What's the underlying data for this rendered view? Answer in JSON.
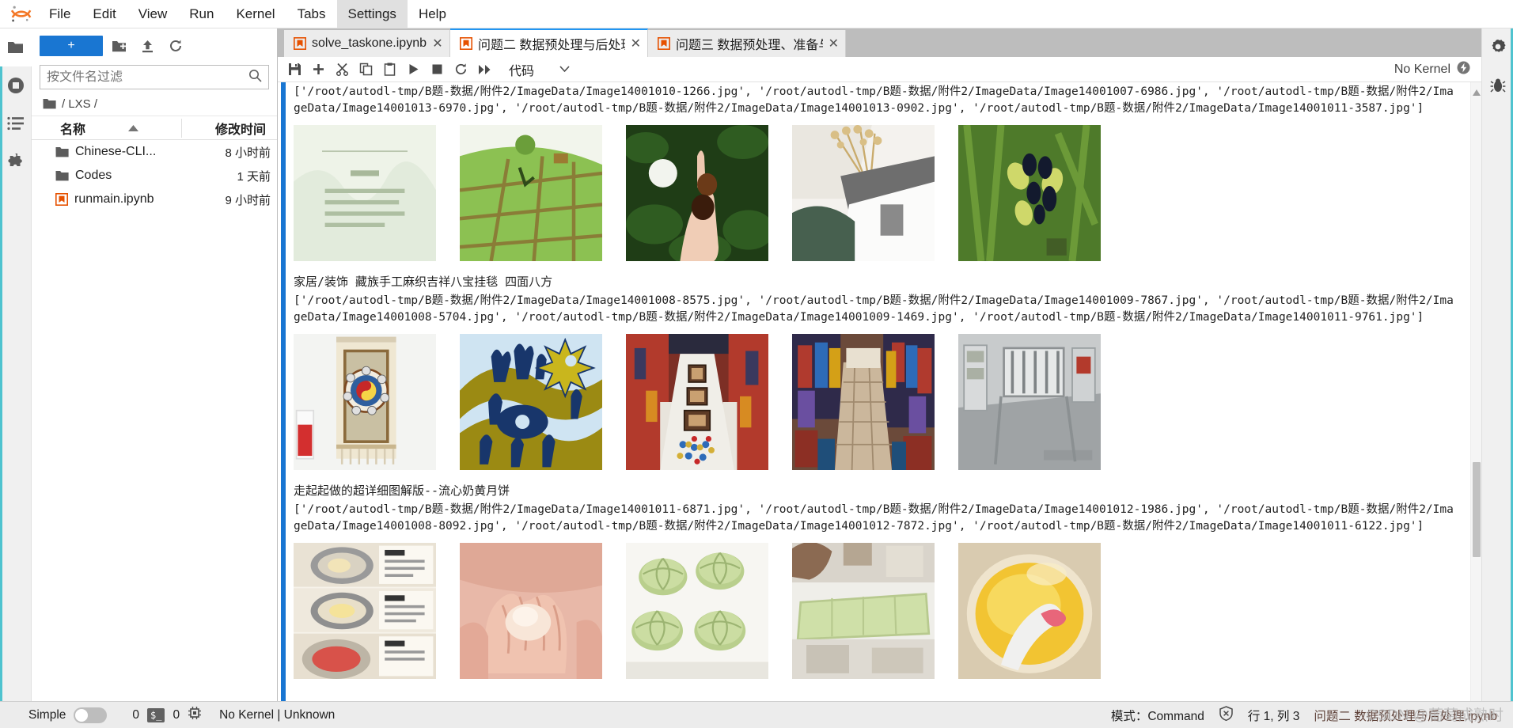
{
  "app": {
    "logo_icon": "jupyter-logo",
    "menus": [
      {
        "label": "File"
      },
      {
        "label": "Edit"
      },
      {
        "label": "View"
      },
      {
        "label": "Run"
      },
      {
        "label": "Kernel"
      },
      {
        "label": "Tabs"
      },
      {
        "label": "Settings",
        "active": true
      },
      {
        "label": "Help"
      }
    ]
  },
  "activity_bar": {
    "items": [
      {
        "name": "file-browser-icon",
        "icon": "folder-icon",
        "selected": true
      },
      {
        "name": "running-terminals-icon",
        "icon": "stop-circle-icon",
        "selected": false
      },
      {
        "name": "table-of-contents-icon",
        "icon": "list-icon",
        "selected": false
      },
      {
        "name": "extension-manager-icon",
        "icon": "puzzle-icon",
        "selected": false
      }
    ]
  },
  "right_bar": {
    "items": [
      {
        "name": "property-inspector-icon",
        "icon": "gear-icon"
      },
      {
        "name": "debugger-icon",
        "icon": "bug-icon"
      }
    ]
  },
  "file_browser": {
    "new_launcher_label": "+",
    "toolbar_icons": [
      "new-folder-icon",
      "upload-icon",
      "refresh-icon"
    ],
    "filter_placeholder": "按文件名过滤",
    "filter_value": "",
    "breadcrumb": "/ LXS /",
    "columns": {
      "name": "名称",
      "modified": "修改时间"
    },
    "sort_indicator": "ascending",
    "rows": [
      {
        "icon": "folder-icon",
        "name": "Chinese-CLI...",
        "modified": "8 小时前"
      },
      {
        "icon": "folder-icon",
        "name": "Codes",
        "modified": "1 天前"
      },
      {
        "icon": "notebook-icon",
        "name": "runmain.ipynb",
        "modified": "9 小时前"
      }
    ]
  },
  "tabs": [
    {
      "icon": "notebook-icon",
      "label": "solve_taskone.ipynb",
      "close": "✕",
      "current": false
    },
    {
      "icon": "notebook-icon",
      "label": "问题二 数据预处理与后处理.i",
      "close": "✕",
      "current": true
    },
    {
      "icon": "notebook-icon",
      "label": "问题三 数据预处理、准备与后",
      "close": "✕",
      "current": false
    }
  ],
  "notebook_toolbar": {
    "buttons": [
      {
        "name": "save-button",
        "icon": "save-icon"
      },
      {
        "name": "insert-cell-button",
        "icon": "plus-icon"
      },
      {
        "name": "cut-cell-button",
        "icon": "scissors-icon"
      },
      {
        "name": "copy-cell-button",
        "icon": "copy-icon"
      },
      {
        "name": "paste-cell-button",
        "icon": "paste-icon"
      },
      {
        "name": "run-cell-button",
        "icon": "play-icon"
      },
      {
        "name": "interrupt-kernel-button",
        "icon": "stop-icon"
      },
      {
        "name": "restart-kernel-button",
        "icon": "restart-icon"
      },
      {
        "name": "restart-run-all-button",
        "icon": "fast-forward-icon"
      }
    ],
    "cell_type": "代码",
    "cell_type_chevron": "chevron-down-icon",
    "kernel_label": "No Kernel",
    "kernel_icon": "kernel-idle-icon"
  },
  "notebook_output": {
    "blocks": [
      {
        "title": "",
        "text": "['/root/autodl-tmp/B题-数据/附件2/ImageData/Image14001010-1266.jpg', '/root/autodl-tmp/B题-数据/附件2/ImageData/Image14001007-6986.jpg', '/root/autodl-tmp/B题-数据/附件2/ImageData/Image14001013-6970.jpg', '/root/autodl-tmp/B题-数据/附件2/ImageData/Image14001013-0902.jpg', '/root/autodl-tmp/B题-数据/附件2/ImageData/Image14001011-3587.jpg']",
        "images": [
          "img-book-cover-green",
          "img-green-field-map",
          "img-hand-fruit",
          "img-dried-flower-book",
          "img-black-berries"
        ]
      },
      {
        "title": "家居/装饰 藏族手工麻织吉祥八宝挂毯 四面八方",
        "text": "['/root/autodl-tmp/B题-数据/附件2/ImageData/Image14001008-8575.jpg', '/root/autodl-tmp/B题-数据/附件2/ImageData/Image14001009-7867.jpg', '/root/autodl-tmp/B题-数据/附件2/ImageData/Image14001008-5704.jpg', '/root/autodl-tmp/B题-数据/附件2/ImageData/Image14001009-1469.jpg', '/root/autodl-tmp/B题-数据/附件2/ImageData/Image14001011-9761.jpg']",
        "images": [
          "img-tibetan-tapestry",
          "img-blue-yellow-batik",
          "img-craft-market-table",
          "img-textile-bazaar",
          "img-gallery-corridor"
        ]
      },
      {
        "title": "走起起做的超详细图解版--流心奶黄月饼",
        "text": "['/root/autodl-tmp/B题-数据/附件2/ImageData/Image14001011-6871.jpg', '/root/autodl-tmp/B题-数据/附件2/ImageData/Image14001012-1986.jpg', '/root/autodl-tmp/B题-数据/附件2/ImageData/Image14001008-8092.jpg', '/root/autodl-tmp/B题-数据/附件2/ImageData/Image14001012-7872.jpg', '/root/autodl-tmp/B题-数据/附件2/ImageData/Image14001011-6122.jpg']",
        "images": [
          "img-pastry-steps",
          "img-hands-dough",
          "img-green-mooncakes",
          "img-baking-tray",
          "img-egg-yolk-bowl"
        ]
      }
    ]
  },
  "status_bar": {
    "simple_label": "Simple",
    "simple_on": false,
    "kernel_count": "0",
    "terminal_badge": "$_",
    "terminal_count": "0",
    "cpu_icon": "chip-icon",
    "kernel_text": "No Kernel | Unknown",
    "mode_label": "模式：",
    "mode_value": "Command",
    "shield_icon": "shield-x-icon",
    "position": "行 1, 列 3",
    "filename": "问题二 数据预处理与后处理.ipynb",
    "watermark": "CSDN @葡萄成熟时"
  },
  "colors": {
    "accent_blue": "#1976d2",
    "tab_active_border": "#2196f3",
    "activity_edge": "#4fc3cf",
    "notebook_icon": "#e65100",
    "panel_bg": "#bdbdbd",
    "status_bg": "#ececec"
  }
}
